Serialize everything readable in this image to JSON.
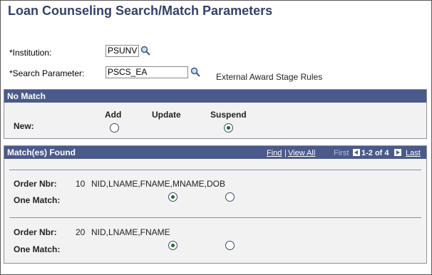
{
  "page": {
    "title": "Loan Counseling Search/Match Parameters"
  },
  "fields": {
    "institution_label": "*Institution:",
    "institution_value": "PSUNV",
    "search_param_label": "*Search Parameter:",
    "search_param_value": "PSCS_EA",
    "search_param_desc": "External Award Stage Rules"
  },
  "no_match": {
    "header": "No Match",
    "columns": [
      "Add",
      "Update",
      "Suspend"
    ],
    "row_label": "New:",
    "selected": "Suspend"
  },
  "matches": {
    "header": "Match(es) Found",
    "nav": {
      "find": "Find",
      "separator": "|",
      "view_all": "View All",
      "first": "First",
      "range": "1-2 of 4",
      "last": "Last"
    },
    "rows": [
      {
        "order_label": "Order Nbr:",
        "order_nbr": "10",
        "fields": "NID,LNAME,FNAME,MNAME,DOB",
        "one_match_label": "One Match:",
        "selected_option": 1
      },
      {
        "order_label": "Order Nbr:",
        "order_nbr": "20",
        "fields": "NID,LNAME,FNAME",
        "one_match_label": "One Match:",
        "selected_option": 1
      }
    ]
  },
  "colors": {
    "title": "#35416a",
    "section_header": "#4a5a8a",
    "section_bg": "#f2f2f2",
    "radio_dot": "#1e6e1e"
  }
}
